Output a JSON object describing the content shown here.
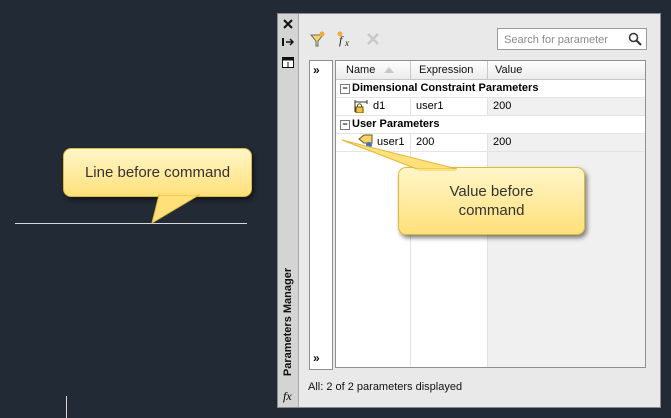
{
  "callouts": {
    "line": "Line before command",
    "value": "Value before command"
  },
  "palette": {
    "title": "Parameters Manager",
    "close_icon": "close-icon",
    "fx_label": "fx",
    "search_placeholder": "Search for parameter",
    "status": "All: 2 of 2 parameters displayed",
    "columns": [
      "Name",
      "Expression",
      "Value"
    ],
    "groups": [
      {
        "title": "Dimensional Constraint Parameters",
        "rows": [
          {
            "name": "d1",
            "expression": "user1",
            "value": "200"
          }
        ]
      },
      {
        "title": "User Parameters",
        "rows": [
          {
            "name": "user1",
            "expression": "200",
            "value": "200"
          }
        ]
      }
    ]
  }
}
